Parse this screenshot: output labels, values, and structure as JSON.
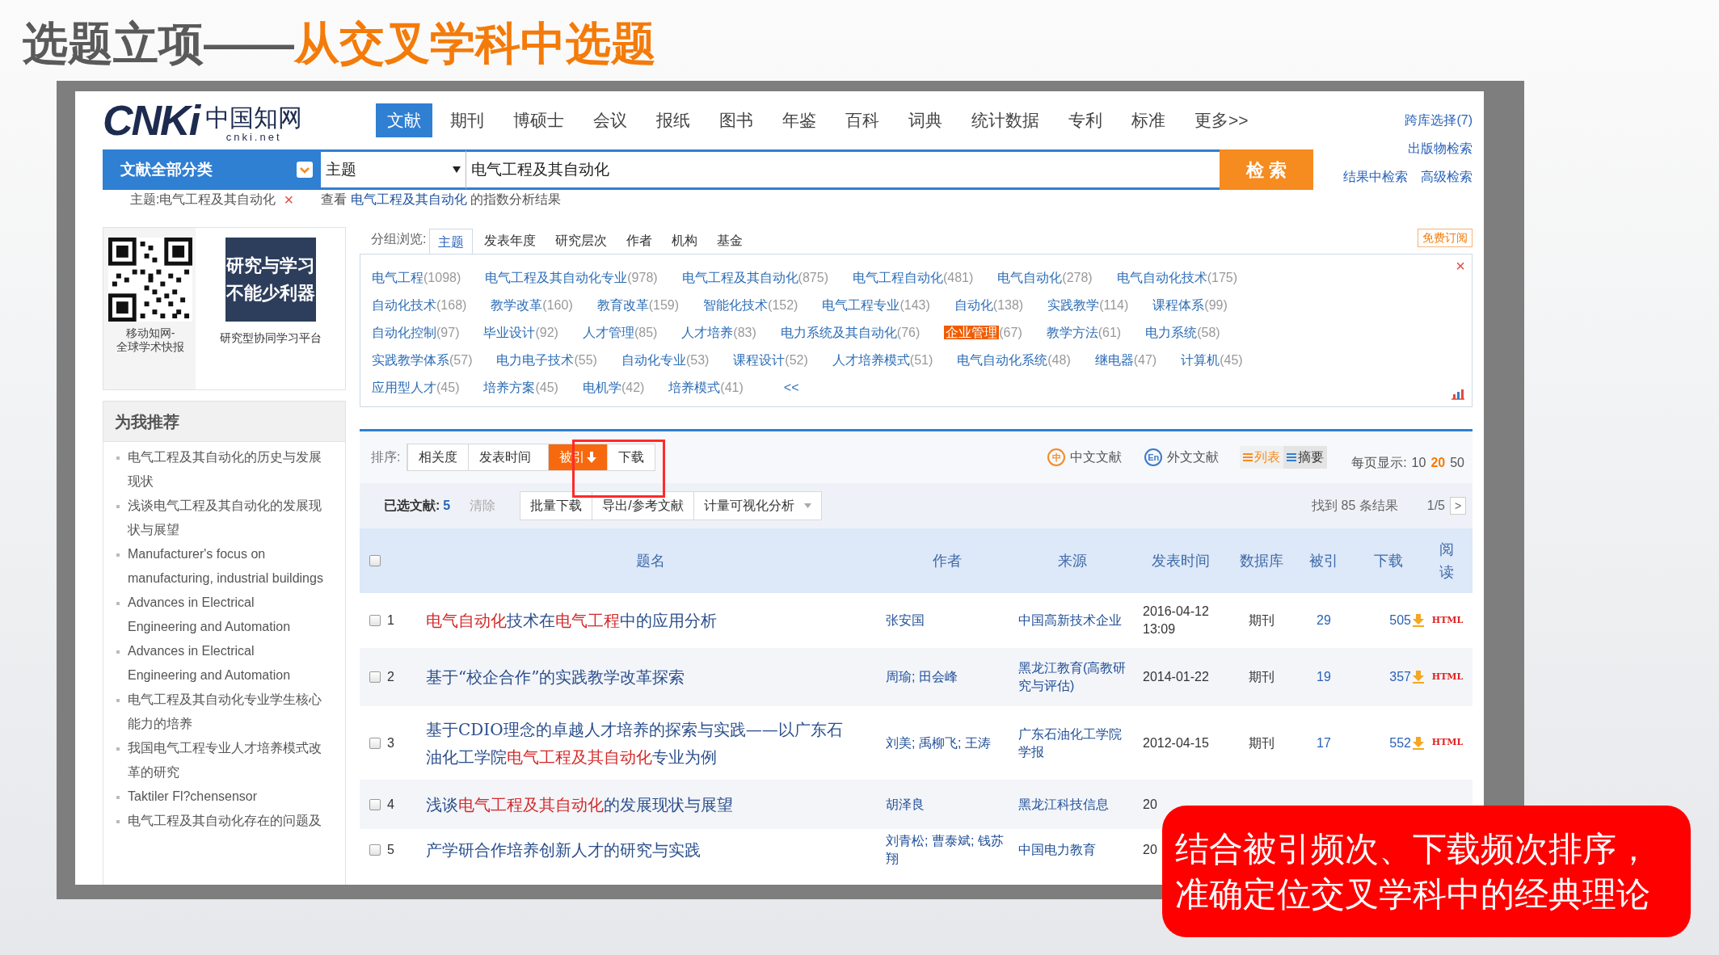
{
  "slide_title": {
    "lead": "选题立项——",
    "highlight": "从交叉学科中选题"
  },
  "logo": {
    "letters": "CNKi",
    "chinese": "中国知网",
    "domain": "cnki.net"
  },
  "nav": [
    {
      "label": "文献",
      "selected": true
    },
    {
      "label": "期刊",
      "selected": false
    },
    {
      "label": "博硕士",
      "selected": false
    },
    {
      "label": "会议",
      "selected": false
    },
    {
      "label": "报纸",
      "selected": false
    },
    {
      "label": "图书",
      "selected": false
    },
    {
      "label": "年鉴",
      "selected": false
    },
    {
      "label": "百科",
      "selected": false
    },
    {
      "label": "词典",
      "selected": false
    },
    {
      "label": "统计数据",
      "selected": false
    },
    {
      "label": "专利",
      "selected": false
    },
    {
      "label": "标准",
      "selected": false
    },
    {
      "label": "更多>>",
      "selected": false
    }
  ],
  "right_links": [
    "跨库选择(7)",
    "出版物检索",
    "结果中检索",
    "高级检索"
  ],
  "search": {
    "category": "文献全部分类",
    "field": "主题",
    "value": "电气工程及其自动化",
    "button": "检 索"
  },
  "query": {
    "term": "主题:电气工程及其自动化",
    "remove": "×",
    "prefix": "查看",
    "link": "电气工程及其自动化",
    "suffix": "的指数分析结果"
  },
  "promo": {
    "qr_caption": [
      "移动知网-",
      "全球学术快报"
    ],
    "banner_lines": [
      "研究与学习",
      "不能少利器"
    ],
    "banner_caption": "研究型协同学习平台"
  },
  "recommend": {
    "title": "为我推荐",
    "items": [
      "电气工程及其自动化的历史与发展现状",
      "浅谈电气工程及其自动化的发展现状与展望",
      "Manufacturer's focus on manufacturing, industrial buildings",
      "Advances in Electrical Engineering and Automation",
      "Advances in Electrical Engineering and Automation",
      "电气工程及其自动化专业学生核心能力的培养",
      "我国电气工程专业人才培养模式改革的研究",
      "Taktiler Fl?chensensor",
      "电气工程及其自动化存在的问题及"
    ]
  },
  "groups": {
    "label": "分组浏览:",
    "tabs": [
      {
        "label": "主题",
        "selected": true
      },
      {
        "label": "发表年度",
        "selected": false
      },
      {
        "label": "研究层次",
        "selected": false
      },
      {
        "label": "作者",
        "selected": false
      },
      {
        "label": "机构",
        "selected": false
      },
      {
        "label": "基金",
        "selected": false
      }
    ],
    "subscribe": "免费订阅",
    "close": "×",
    "collapse": "<<",
    "topic_rows": [
      [
        {
          "name": "电气工程",
          "count": "(1098)",
          "selected": false
        },
        {
          "name": "电气工程及其自动化专业",
          "count": "(978)",
          "selected": false
        },
        {
          "name": "电气工程及其自动化",
          "count": "(875)",
          "selected": false
        },
        {
          "name": "电气工程自动化",
          "count": "(481)",
          "selected": false
        },
        {
          "name": "电气自动化",
          "count": "(278)",
          "selected": false
        },
        {
          "name": "电气自动化技术",
          "count": "(175)",
          "selected": false
        }
      ],
      [
        {
          "name": "自动化技术",
          "count": "(168)",
          "selected": false
        },
        {
          "name": "教学改革",
          "count": "(160)",
          "selected": false
        },
        {
          "name": "教育改革",
          "count": "(159)",
          "selected": false
        },
        {
          "name": "智能化技术",
          "count": "(152)",
          "selected": false
        },
        {
          "name": "电气工程专业",
          "count": "(143)",
          "selected": false
        },
        {
          "name": "自动化",
          "count": "(138)",
          "selected": false
        },
        {
          "name": "实践教学",
          "count": "(114)",
          "selected": false
        },
        {
          "name": "课程体系",
          "count": "(99)",
          "selected": false
        }
      ],
      [
        {
          "name": "自动化控制",
          "count": "(97)",
          "selected": false
        },
        {
          "name": "毕业设计",
          "count": "(92)",
          "selected": false
        },
        {
          "name": "人才管理",
          "count": "(85)",
          "selected": false
        },
        {
          "name": "人才培养",
          "count": "(83)",
          "selected": false
        },
        {
          "name": "电力系统及其自动化",
          "count": "(76)",
          "selected": false
        },
        {
          "name": "企业管理",
          "count": "(67)",
          "selected": true
        },
        {
          "name": "教学方法",
          "count": "(61)",
          "selected": false
        },
        {
          "name": "电力系统",
          "count": "(58)",
          "selected": false
        }
      ],
      [
        {
          "name": "实践教学体系",
          "count": "(57)",
          "selected": false
        },
        {
          "name": "电力电子技术",
          "count": "(55)",
          "selected": false
        },
        {
          "name": "自动化专业",
          "count": "(53)",
          "selected": false
        },
        {
          "name": "课程设计",
          "count": "(52)",
          "selected": false
        },
        {
          "name": "人才培养模式",
          "count": "(51)",
          "selected": false
        },
        {
          "name": "电气自动化系统",
          "count": "(48)",
          "selected": false
        },
        {
          "name": "继电器",
          "count": "(47)",
          "selected": false
        },
        {
          "name": "计算机",
          "count": "(45)",
          "selected": false
        }
      ],
      [
        {
          "name": "应用型人才",
          "count": "(45)",
          "selected": false
        },
        {
          "name": "培养方案",
          "count": "(45)",
          "selected": false
        },
        {
          "name": "电机学",
          "count": "(42)",
          "selected": false
        },
        {
          "name": "培养模式",
          "count": "(41)",
          "selected": false
        }
      ]
    ]
  },
  "sort": {
    "label": "排序:",
    "options": [
      {
        "label": "相关度",
        "selected": false
      },
      {
        "label": "发表时间",
        "selected": false
      },
      {
        "label": "被引",
        "selected": true
      },
      {
        "label": "下载",
        "selected": false
      }
    ],
    "languages": [
      {
        "badge": "中",
        "label": "中文文献"
      },
      {
        "badge": "En",
        "label": "外文文献"
      }
    ],
    "views": [
      {
        "label": "列表",
        "selected": true
      },
      {
        "label": "摘要",
        "selected": false
      }
    ],
    "per_page_label": "每页显示:",
    "per_page": [
      {
        "label": "10",
        "selected": false
      },
      {
        "label": "20",
        "selected": true
      },
      {
        "label": "50",
        "selected": false
      }
    ]
  },
  "selection": {
    "label": "已选文献:",
    "count": "5",
    "clear": "清除",
    "actions": [
      "批量下载",
      "导出/参考文献",
      "计量可视化分析"
    ],
    "found": "找到 85 条结果",
    "page": "1/5",
    "next": ">"
  },
  "table": {
    "header_checked": false,
    "columns": [
      "题名",
      "作者",
      "来源",
      "发表时间",
      "数据库",
      "被引",
      "下载",
      "阅读"
    ],
    "rows": [
      {
        "num": "1",
        "checked": false,
        "title": [
          {
            "text": "电气自动化",
            "hit": true
          },
          {
            "text": "技术在",
            "hit": false
          },
          {
            "text": "电气工程",
            "hit": true
          },
          {
            "text": "中的应用分析",
            "hit": false
          }
        ],
        "authors": "张安国",
        "source": "中国高新技术企业",
        "date": "2016-04-12 13:09",
        "db": "期刊",
        "cited": "29",
        "downloads": "505",
        "read": "HTML"
      },
      {
        "num": "2",
        "checked": false,
        "title": [
          {
            "text": "基于“校企合作”的实践教学改革探索",
            "hit": false
          }
        ],
        "authors": "周瑜; 田会峰",
        "source": "黑龙江教育(高教研究与评估)",
        "date": "2014-01-22",
        "db": "期刊",
        "cited": "19",
        "downloads": "357",
        "read": "HTML"
      },
      {
        "num": "3",
        "checked": false,
        "title": [
          {
            "text": "基于CDIO理念的卓越人才培养的探索与实践——以广东石油化工学院",
            "hit": false
          },
          {
            "text": "电气工程及其自动化",
            "hit": true
          },
          {
            "text": "专业为例",
            "hit": false
          }
        ],
        "authors": "刘美; 禹柳飞; 王涛",
        "source": "广东石油化工学院学报",
        "date": "2012-04-15",
        "db": "期刊",
        "cited": "17",
        "downloads": "552",
        "read": "HTML"
      },
      {
        "num": "4",
        "checked": false,
        "title": [
          {
            "text": "浅谈",
            "hit": false
          },
          {
            "text": "电气工程及其自动化",
            "hit": true
          },
          {
            "text": "的发展现状与展望",
            "hit": false
          }
        ],
        "authors": "胡泽良",
        "source": "黑龙江科技信息",
        "date": "20"
      },
      {
        "num": "5",
        "checked": false,
        "title": [
          {
            "text": "产学研合作培养创新人才的研究与实践",
            "hit": false
          }
        ],
        "authors": "刘青松; 曹泰斌; 钱苏翔",
        "source": "中国电力教育",
        "date": "20"
      }
    ]
  },
  "callout": [
    "结合被引频次、下载频次排序，",
    "准确定位交叉学科中的经典理论"
  ]
}
